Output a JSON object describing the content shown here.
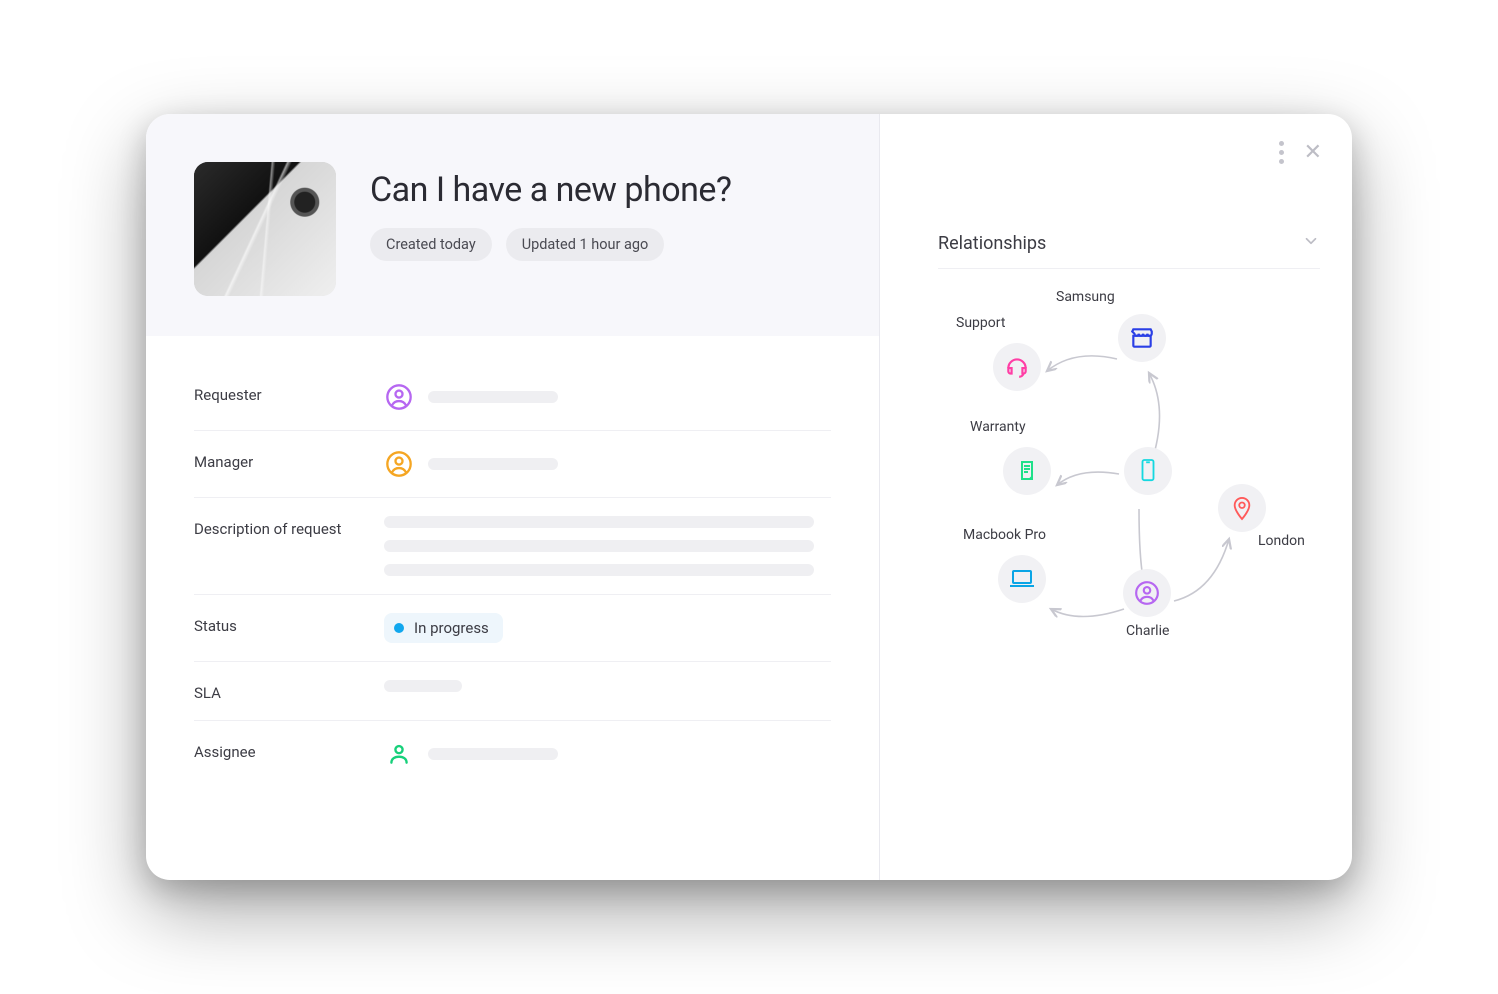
{
  "ticket": {
    "title": "Can I have a new phone?",
    "created_pill": "Created  today",
    "updated_pill": "Updated 1 hour ago"
  },
  "fields": {
    "requester_label": "Requester",
    "manager_label": "Manager",
    "description_label": "Description of request",
    "status_label": "Status",
    "status_value": "In progress",
    "sla_label": "SLA",
    "assignee_label": "Assignee"
  },
  "side": {
    "section_title": "Relationships",
    "nodes": {
      "samsung": "Samsung",
      "support": "Support",
      "warranty": "Warranty",
      "macbook": "Macbook Pro",
      "charlie": "Charlie",
      "london": "London"
    }
  },
  "icons": {
    "requester": "person-circle-icon",
    "manager": "person-circle-icon",
    "assignee": "person-icon"
  }
}
